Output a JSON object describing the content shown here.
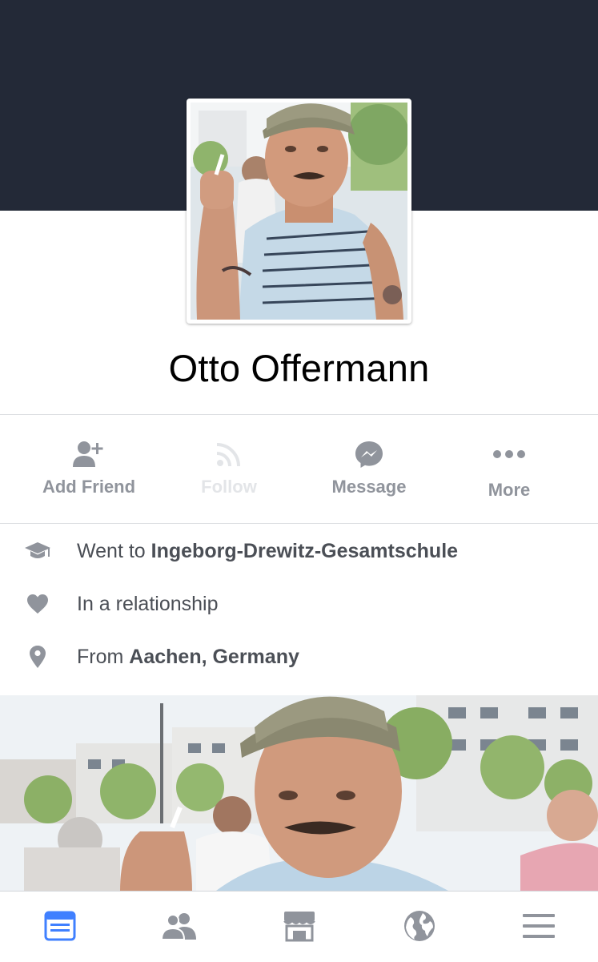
{
  "profile": {
    "name": "Otto Offermann",
    "photo_description_icon": "person-with-cap-photo"
  },
  "actions": [
    {
      "label": "Add Friend",
      "icon": "add-friend-icon",
      "enabled": true
    },
    {
      "label": "Follow",
      "icon": "follow-icon",
      "enabled": false
    },
    {
      "label": "Message",
      "icon": "messenger-icon",
      "enabled": true
    },
    {
      "label": "More",
      "icon": "more-icon",
      "enabled": true
    }
  ],
  "intro": {
    "education": {
      "prefix": "Went to",
      "value": "Ingeborg-Drewitz-Gesamtschule",
      "icon": "graduation-cap-icon"
    },
    "relationship": {
      "text": "In a relationship",
      "icon": "heart-icon"
    },
    "hometown": {
      "prefix": "From",
      "value": "Aachen, Germany",
      "icon": "location-pin-icon"
    }
  },
  "tabbar": {
    "items": [
      {
        "name": "news-feed",
        "icon": "news-feed-icon",
        "active": true
      },
      {
        "name": "friends",
        "icon": "friends-icon",
        "active": false
      },
      {
        "name": "marketplace",
        "icon": "marketplace-icon",
        "active": false
      },
      {
        "name": "notifications",
        "icon": "globe-icon",
        "active": false
      },
      {
        "name": "menu",
        "icon": "hamburger-menu-icon",
        "active": false
      }
    ]
  },
  "colors": {
    "cover": "#232937",
    "icon_gray": "#90949c",
    "text_dark": "#4b4f56",
    "accent_blue": "#4080ff",
    "disabled": "#e3e5e8"
  }
}
